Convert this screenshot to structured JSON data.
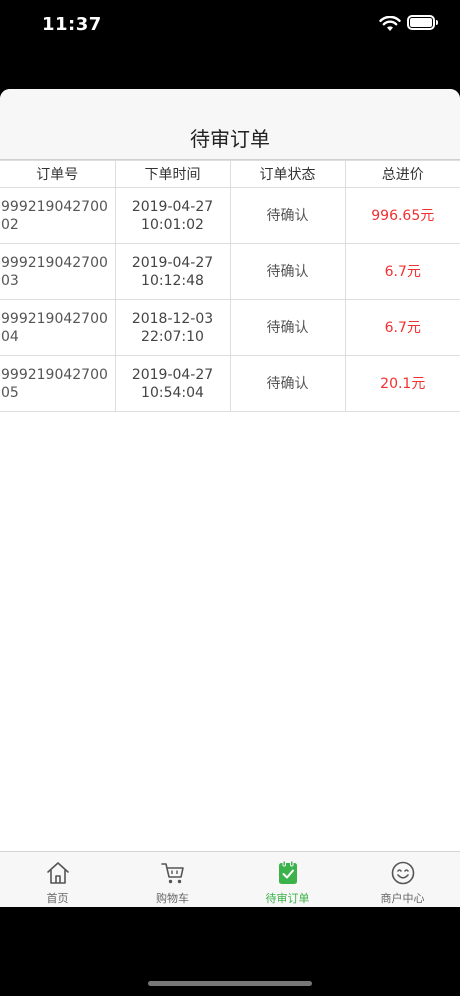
{
  "status_bar": {
    "time": "11:37",
    "icons": [
      "wifi-icon",
      "battery-icon"
    ]
  },
  "header": {
    "title": "待审订单"
  },
  "table": {
    "columns": [
      "订单号",
      "下单时间",
      "订单状态",
      "总进价"
    ],
    "rows": [
      {
        "order_no": "99921904270002",
        "time": "2019-04-27 10:01:02",
        "status": "待确认",
        "price": "996.65元"
      },
      {
        "order_no": "99921904270003",
        "time": "2019-04-27 10:12:48",
        "status": "待确认",
        "price": "6.7元"
      },
      {
        "order_no": "99921904270004",
        "time": "2018-12-03 22:07:10",
        "status": "待确认",
        "price": "6.7元"
      },
      {
        "order_no": "99921904270005",
        "time": "2019-04-27 10:54:04",
        "status": "待确认",
        "price": "20.1元"
      }
    ]
  },
  "tabbar": {
    "items": [
      {
        "label": "首页",
        "icon": "home-icon",
        "active": false
      },
      {
        "label": "购物车",
        "icon": "cart-icon",
        "active": false
      },
      {
        "label": "待审订单",
        "icon": "clipboard-check-icon",
        "active": true
      },
      {
        "label": "商户中心",
        "icon": "smile-icon",
        "active": false
      }
    ]
  },
  "colors": {
    "accent": "#3cb34a",
    "price": "#f23030",
    "header_bg": "#f7f7f7"
  }
}
